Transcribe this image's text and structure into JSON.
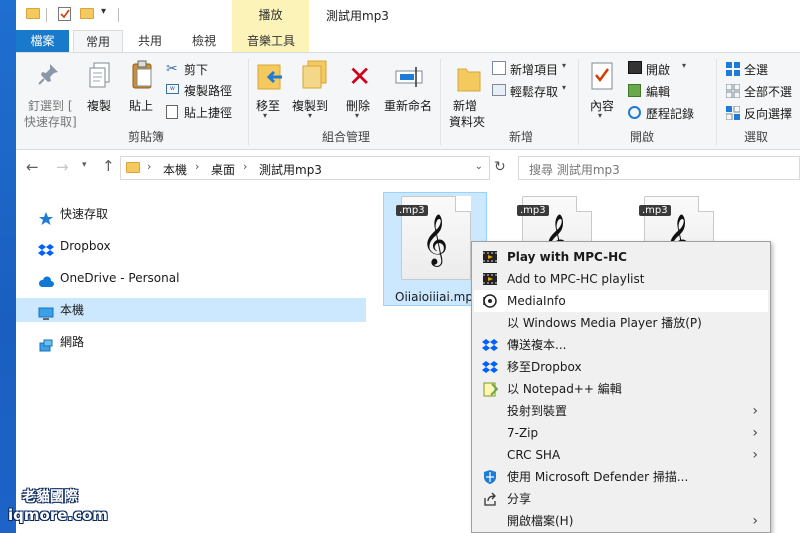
{
  "window": {
    "title": "測試用mp3",
    "context_tab": "播放"
  },
  "ribbon_tabs": [
    "檔案",
    "常用",
    "共用",
    "檢視",
    "音樂工具"
  ],
  "ribbon": {
    "pin_quick_access": "釘選到 [",
    "pin_quick_access_2": "快速存取]",
    "copy": "複製",
    "paste": "貼上",
    "cut": "剪下",
    "copy_path": "複製路徑",
    "paste_shortcut": "貼上捷徑",
    "group_clipboard": "剪貼簿",
    "move_to": "移至",
    "copy_to": "複製到",
    "delete": "刪除",
    "rename": "重新命名",
    "group_organize": "組合管理",
    "new_folder": "新增",
    "new_folder_2": "資料夾",
    "new_item": "新增項目",
    "easy_access": "輕鬆存取",
    "group_new": "新增",
    "properties": "內容",
    "open": "開啟",
    "edit": "編輯",
    "history": "歷程記錄",
    "group_open": "開啟",
    "select_all": "全選",
    "select_none": "全部不選",
    "invert_selection": "反向選擇",
    "group_select": "選取"
  },
  "address": {
    "segments": [
      "本機",
      "桌面",
      "測試用mp3"
    ],
    "search_placeholder": "搜尋 測試用mp3"
  },
  "nav_pane": [
    "快速存取",
    "Dropbox",
    "OneDrive - Personal",
    "本機",
    "網路"
  ],
  "files": [
    {
      "badge": ".mp3",
      "name": "Oiiaioiiiai.mp"
    },
    {
      "badge": ".mp3",
      "name": ""
    },
    {
      "badge": ".mp3",
      "name": ""
    }
  ],
  "context_menu": [
    {
      "label": "Play with MPC-HC",
      "icon": "mpc-hc-icon",
      "bold": true,
      "submenu": false
    },
    {
      "label": "Add to MPC-HC playlist",
      "icon": "mpc-hc-icon",
      "bold": false,
      "submenu": false
    },
    {
      "label": "MediaInfo",
      "icon": "mediainfo-icon",
      "bold": false,
      "submenu": false
    },
    {
      "label": "以 Windows Media Player 播放(P)",
      "icon": "",
      "bold": false,
      "submenu": false
    },
    {
      "label": "傳送複本...",
      "icon": "dropbox-icon",
      "bold": false,
      "submenu": false
    },
    {
      "label": "移至Dropbox",
      "icon": "dropbox-icon",
      "bold": false,
      "submenu": false
    },
    {
      "label": "以 Notepad++ 編輯",
      "icon": "notepadpp-icon",
      "bold": false,
      "submenu": false
    },
    {
      "label": "投射到裝置",
      "icon": "",
      "bold": false,
      "submenu": true
    },
    {
      "label": "7-Zip",
      "icon": "",
      "bold": false,
      "submenu": true
    },
    {
      "label": "CRC SHA",
      "icon": "",
      "bold": false,
      "submenu": true
    },
    {
      "label": "使用 Microsoft Defender 掃描...",
      "icon": "defender-icon",
      "bold": false,
      "submenu": false
    },
    {
      "label": "分享",
      "icon": "share-icon",
      "bold": false,
      "submenu": false
    },
    {
      "label": "開啟檔案(H)",
      "icon": "",
      "bold": false,
      "submenu": true
    }
  ],
  "watermark": {
    "line1": "老貓國際",
    "line2": "iqmore.com"
  },
  "colors": {
    "file_tab": "#1979ca",
    "selection": "#cce8ff",
    "context_tab_bg": "#fbf3b8"
  }
}
